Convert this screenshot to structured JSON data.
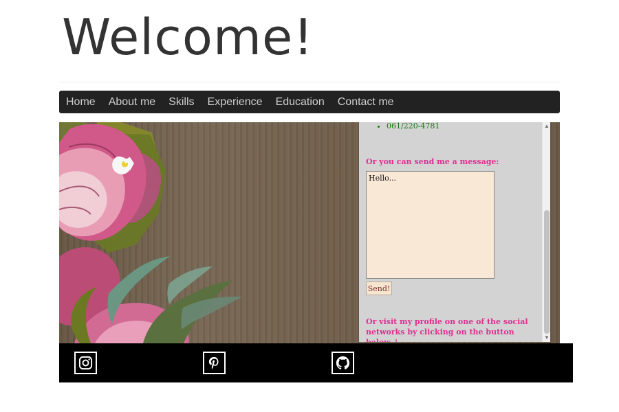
{
  "header": {
    "title": "Welcome!"
  },
  "nav": {
    "items": [
      "Home",
      "About me",
      "Skills",
      "Experience",
      "Education",
      "Contact me"
    ]
  },
  "contact": {
    "phone": "061/220-4781",
    "message_prompt": "Or you can send me a message:",
    "message_text": "Hello...",
    "send_label": "Send!",
    "social_prompt": "Or visit my profile on one of the social networks by clicking on the button below ↓"
  },
  "footer": {
    "icons": [
      "instagram-icon",
      "pinterest-icon",
      "github-icon"
    ]
  },
  "colors": {
    "nav_bg": "#222222",
    "panel_bg": "#d3d3d3",
    "pink_text": "#e12e92",
    "green_text": "#167a12",
    "footer_bg": "#000000"
  }
}
